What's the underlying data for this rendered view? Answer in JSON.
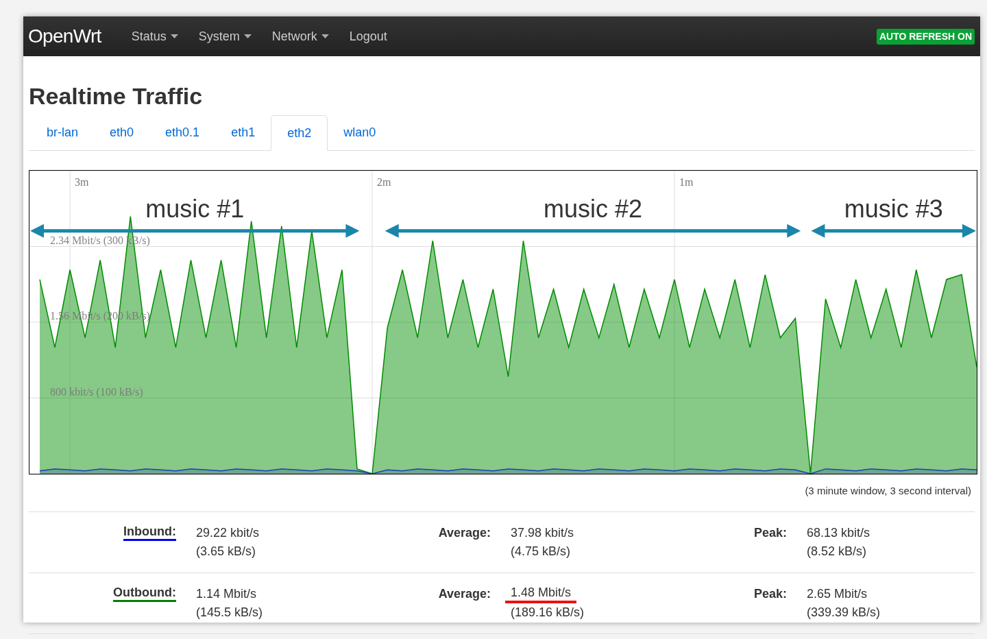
{
  "navbar": {
    "brand": "OpenWrt",
    "menu": [
      {
        "label": "Status",
        "dropdown": true
      },
      {
        "label": "System",
        "dropdown": true
      },
      {
        "label": "Network",
        "dropdown": true
      },
      {
        "label": "Logout",
        "dropdown": false
      }
    ],
    "badge": "AUTO REFRESH ON"
  },
  "title": "Realtime Traffic",
  "tabs": [
    {
      "label": "br-lan",
      "selected": false
    },
    {
      "label": "eth0",
      "selected": false
    },
    {
      "label": "eth0.1",
      "selected": false
    },
    {
      "label": "eth1",
      "selected": false
    },
    {
      "label": "eth2",
      "selected": true
    },
    {
      "label": "wlan0",
      "selected": false
    }
  ],
  "graph": {
    "time_labels": [
      "3m",
      "2m",
      "1m"
    ],
    "rate_labels": [
      "2.34 Mbit/s (300 kB/s)",
      "1.56 Mbit/s (200 kB/s)",
      "800 kbit/s (100 kB/s)"
    ],
    "annotations": [
      "music #1",
      "music #2",
      "music #3"
    ]
  },
  "caption": "(3 minute window, 3 second interval)",
  "stats": [
    {
      "label": "Inbound:",
      "color": "#0000ee",
      "current": [
        "29.22 kbit/s",
        "(3.65 kB/s)"
      ],
      "average_label": "Average:",
      "average": [
        "37.98 kbit/s",
        "(4.75 kB/s)"
      ],
      "average_highlighted": false,
      "peak_label": "Peak:",
      "peak": [
        "68.13 kbit/s",
        "(8.52 kB/s)"
      ]
    },
    {
      "label": "Outbound:",
      "color": "#008000",
      "current": [
        "1.14 Mbit/s",
        "(145.5 kB/s)"
      ],
      "average_label": "Average:",
      "average": [
        "1.48 Mbit/s",
        "(189.16 kB/s)"
      ],
      "average_highlighted": true,
      "peak_label": "Peak:",
      "peak": [
        "2.65 Mbit/s",
        "(339.39 kB/s)"
      ]
    }
  ]
}
